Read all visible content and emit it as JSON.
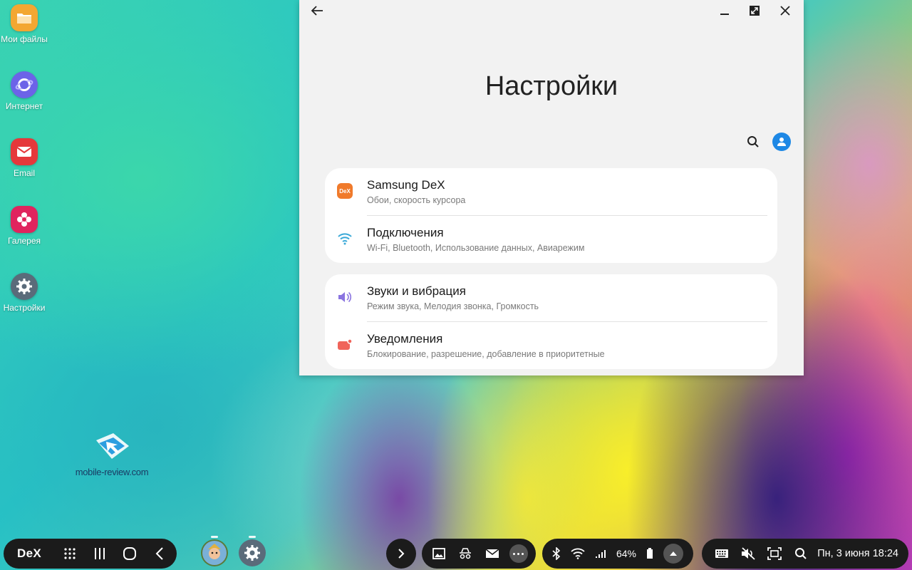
{
  "desktop": {
    "icons": [
      {
        "label": "Мои файлы",
        "icon": "folder-icon",
        "color": "#f3a732"
      },
      {
        "label": "Интернет",
        "icon": "internet-icon",
        "color": "#6c63e8"
      },
      {
        "label": "Email",
        "icon": "email-icon",
        "color": "#e5383b"
      },
      {
        "label": "Галерея",
        "icon": "gallery-icon",
        "color": "#e0245e"
      },
      {
        "label": "Настройки",
        "icon": "settings-icon",
        "color": "#5a6b7a"
      }
    ]
  },
  "watermark": {
    "text": "mobile-review.com"
  },
  "window": {
    "title": "Настройки",
    "cards": [
      {
        "rows": [
          {
            "title": "Samsung DeX",
            "subtitle": "Обои, скорость курсора",
            "icon": "dex-icon",
            "icon_text": "DeX",
            "color": "#f07a2b"
          },
          {
            "title": "Подключения",
            "subtitle": "Wi-Fi, Bluetooth, Использование данных, Авиарежим",
            "icon": "wifi-icon",
            "color": "#3aa9d8"
          }
        ]
      },
      {
        "rows": [
          {
            "title": "Звуки и вибрация",
            "subtitle": "Режим звука, Мелодия звонка, Громкость",
            "icon": "speaker-icon",
            "color": "#8a74e0"
          },
          {
            "title": "Уведомления",
            "subtitle": "Блокирование, разрешение, добавление в приоритетные",
            "icon": "notification-icon",
            "color": "#f0645a"
          }
        ]
      }
    ],
    "accent": "#1e88e5"
  },
  "taskbar": {
    "dex_label": "DeX",
    "battery": "64%",
    "clock": "Пн, 3 июня 18:24"
  }
}
